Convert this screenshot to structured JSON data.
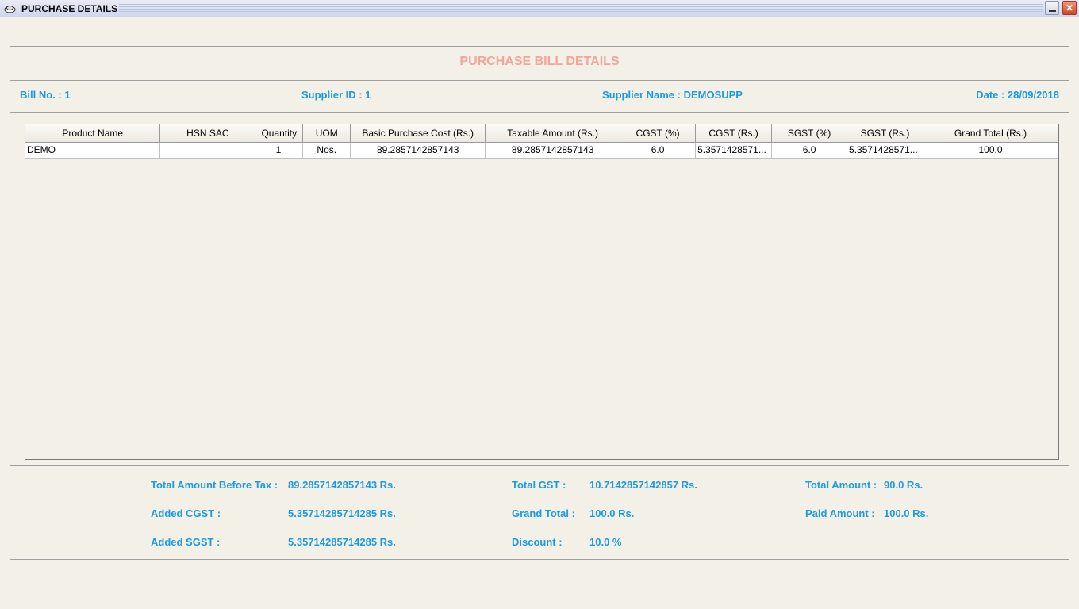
{
  "window": {
    "title": "PURCHASE DETAILS"
  },
  "heading": "PURCHASE BILL DETAILS",
  "bill": {
    "bill_no": "Bill No. :  1",
    "supplier_id": "Supplier ID :  1",
    "supplier_name": "Supplier Name :  DEMOSUPP",
    "date": "Date :  28/09/2018"
  },
  "table": {
    "columns": [
      "Product Name",
      "HSN SAC",
      "Quantity",
      "UOM",
      "Basic Purchase Cost (Rs.)",
      "Taxable Amount (Rs.)",
      "CGST (%)",
      "CGST (Rs.)",
      "SGST (%)",
      "SGST (Rs.)",
      "Grand Total (Rs.)"
    ],
    "rows": [
      [
        "DEMO",
        "",
        "1",
        "Nos.",
        "89.2857142857143",
        "89.2857142857143",
        "6.0",
        "5.3571428571...",
        "6.0",
        "5.3571428571...",
        "100.0"
      ]
    ]
  },
  "summary": {
    "total_before_tax_label": "Total Amount Before Tax :",
    "total_before_tax_value": "89.2857142857143 Rs.",
    "added_cgst_label": "Added CGST :",
    "added_cgst_value": "5.35714285714285 Rs.",
    "added_sgst_label": "Added SGST :",
    "added_sgst_value": "5.35714285714285 Rs.",
    "total_gst_label": "Total GST :",
    "total_gst_value": "10.7142857142857 Rs.",
    "grand_total_label": "Grand Total :",
    "grand_total_value": "100.0 Rs.",
    "discount_label": "Discount :",
    "discount_value": "10.0 %",
    "total_amount_label": "Total Amount :",
    "total_amount_value": "90.0 Rs.",
    "paid_amount_label": "Paid Amount :",
    "paid_amount_value": "100.0 Rs."
  },
  "colors": {
    "heading": "#f4a59a",
    "info": "#1e9be0",
    "background": "#f3f0e8"
  }
}
